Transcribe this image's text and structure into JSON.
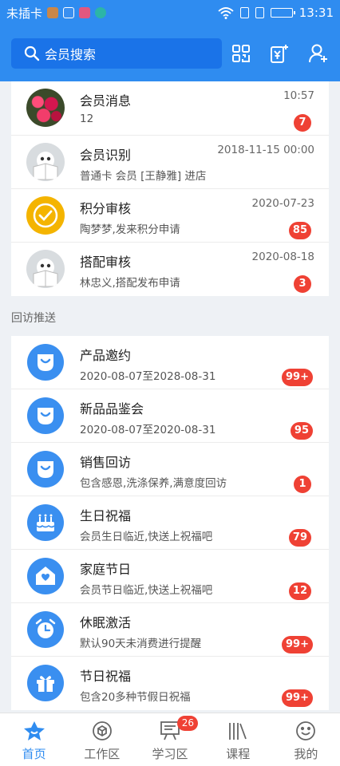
{
  "status_bar": {
    "carrier": "未插卡",
    "time": "13:31"
  },
  "header": {
    "search_placeholder": "会员搜索"
  },
  "messages": [
    {
      "title": "会员消息",
      "sub": "12",
      "time": "10:57",
      "badge": "7",
      "avatar": "flowers-photo"
    },
    {
      "title": "会员识别",
      "sub": "普通卡 会员 [王静雅] 进店",
      "time": "2018-11-15 00:00",
      "badge": "",
      "avatar": "penguin-avatar"
    },
    {
      "title": "积分审核",
      "sub": "陶梦梦,发来积分申请",
      "time": "2020-07-23",
      "badge": "85",
      "avatar": "check-badge"
    },
    {
      "title": "搭配审核",
      "sub": "林忠义,搭配发布申请",
      "time": "2020-08-18",
      "badge": "3",
      "avatar": "penguin-avatar"
    }
  ],
  "section_label": "回访推送",
  "followups": [
    {
      "title": "产品邀约",
      "sub": "2020-08-07至2028-08-31",
      "badge": "99+",
      "icon": "pocket-icon"
    },
    {
      "title": "新品品鉴会",
      "sub": "2020-08-07至2020-08-31",
      "badge": "95",
      "icon": "pocket-icon"
    },
    {
      "title": "销售回访",
      "sub": "包含感恩,洗涤保养,满意度回访",
      "badge": "1",
      "icon": "pocket-icon"
    },
    {
      "title": "生日祝福",
      "sub": "会员生日临近,快送上祝福吧",
      "badge": "79",
      "icon": "cake-icon"
    },
    {
      "title": "家庭节日",
      "sub": "会员节日临近,快送上祝福吧",
      "badge": "12",
      "icon": "home-heart-icon"
    },
    {
      "title": "休眠激活",
      "sub": "默认90天未消费进行提醒",
      "badge": "99+",
      "icon": "alarm-clock-icon"
    },
    {
      "title": "节日祝福",
      "sub": "包含20多种节假日祝福",
      "badge": "99+",
      "icon": "gift-icon"
    }
  ],
  "tabs": [
    {
      "label": "首页",
      "icon": "home-star-icon",
      "active": true,
      "badge": ""
    },
    {
      "label": "工作区",
      "icon": "cube-icon",
      "active": false,
      "badge": ""
    },
    {
      "label": "学习区",
      "icon": "board-icon",
      "active": false,
      "badge": "26"
    },
    {
      "label": "课程",
      "icon": "books-icon",
      "active": false,
      "badge": ""
    },
    {
      "label": "我的",
      "icon": "smile-icon",
      "active": false,
      "badge": ""
    }
  ],
  "colors": {
    "brand_blue": "#2f8cf0",
    "badge_red": "#ef4134",
    "background": "#eef1f5"
  }
}
